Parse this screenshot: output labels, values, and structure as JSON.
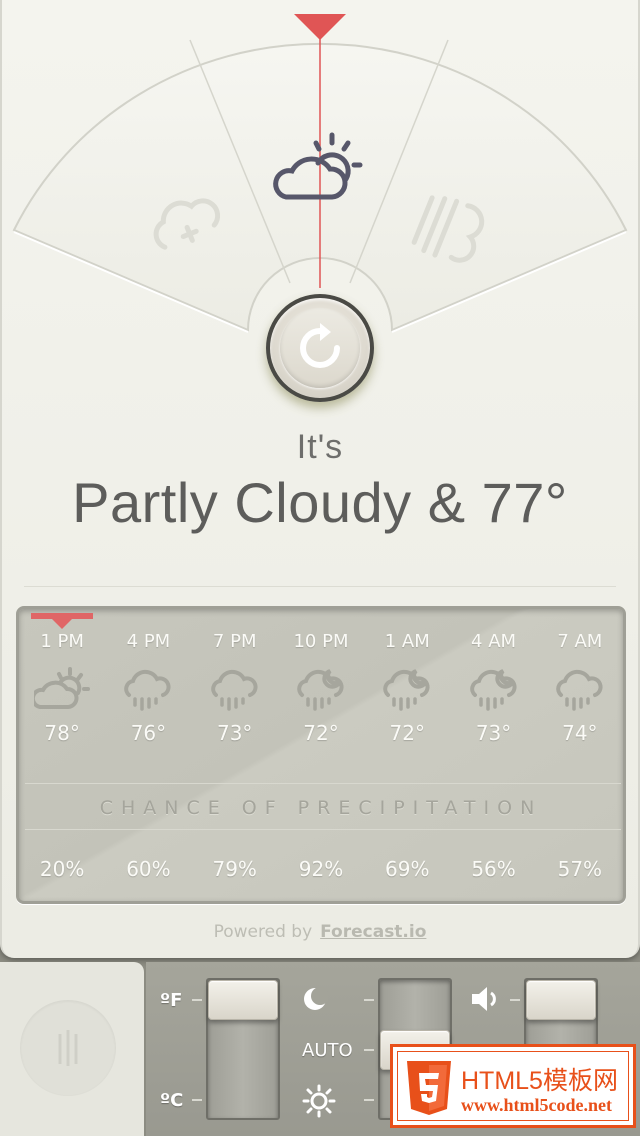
{
  "dial": {
    "left_icon": "cloud-snow-icon",
    "center_icon": "partly-cloudy-icon",
    "right_icon": "wind-rain-icon",
    "pointer_color": "#e05555",
    "refresh_icon": "refresh-icon"
  },
  "summary": {
    "prefix": "It's",
    "text": "Partly Cloudy & 77°"
  },
  "forecast": {
    "hours": [
      {
        "time": "1 PM",
        "icon": "partly-cloudy-icon",
        "temp": "78°"
      },
      {
        "time": "4 PM",
        "icon": "rain-icon",
        "temp": "76°"
      },
      {
        "time": "7 PM",
        "icon": "rain-icon",
        "temp": "73°"
      },
      {
        "time": "10 PM",
        "icon": "night-rain-icon",
        "temp": "72°"
      },
      {
        "time": "1 AM",
        "icon": "night-rain-icon",
        "temp": "72°"
      },
      {
        "time": "4 AM",
        "icon": "night-rain-icon",
        "temp": "73°"
      },
      {
        "time": "7 AM",
        "icon": "rain-icon",
        "temp": "74°"
      }
    ],
    "precip_label": "CHANCE OF PRECIPITATION",
    "precip": [
      "20%",
      "60%",
      "79%",
      "92%",
      "69%",
      "56%",
      "57%"
    ]
  },
  "powered": {
    "text": "Powered by",
    "brand": "Forecast.io"
  },
  "settings": {
    "unit_top": "ºF",
    "unit_bottom": "ºC",
    "mode_auto": "AUTO",
    "moon_icon": "moon-icon",
    "sun_icon": "sun-icon",
    "sound_icon": "speaker-icon"
  },
  "watermark": {
    "title": "HTML5模板网",
    "url": "www.html5code.net"
  }
}
